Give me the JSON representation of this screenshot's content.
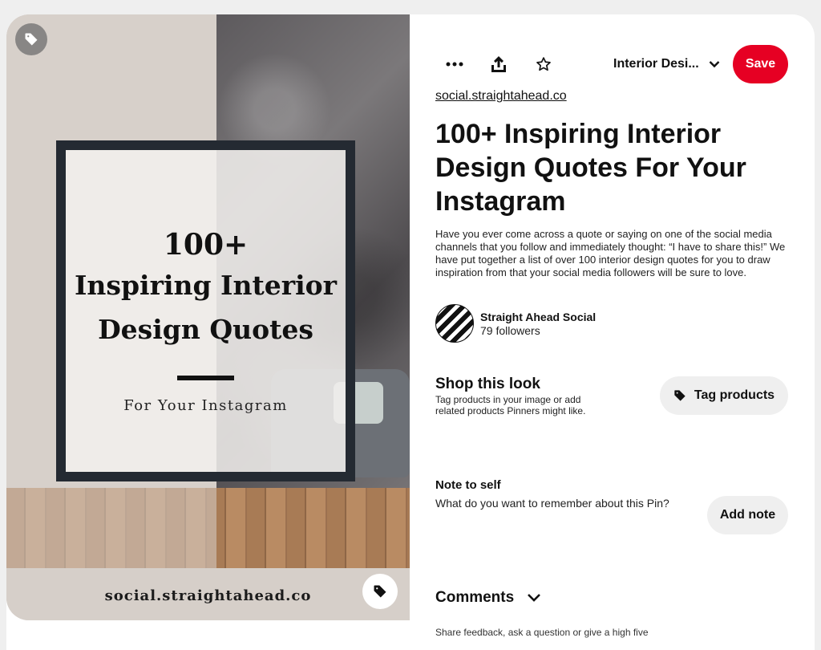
{
  "image": {
    "quote_line1": "100+",
    "quote_line2": "Inspiring Interior",
    "quote_line3": "Design Quotes",
    "quote_sub": "For Your Instagram",
    "footer_text": "social.straightahead.co"
  },
  "toolbar": {
    "icons": [
      "more-icon",
      "share-icon",
      "star-icon"
    ],
    "board_name": "Interior Desi...",
    "save_label": "Save"
  },
  "pin": {
    "source": "social.straightahead.co",
    "title": "100+ Inspiring Interior Design Quotes For Your Instagram",
    "description": "Have you ever come across a quote or saying on one of the social media channels that you follow and immediately thought: “I have to share this!” We have put together a list of over 100 interior design quotes for you to draw inspiration from that your social media followers will be sure to love."
  },
  "creator": {
    "name": "Straight Ahead Social",
    "followers": "79 followers"
  },
  "shop": {
    "title": "Shop this look",
    "description": "Tag products in your image or add related products Pinners might like.",
    "button_label": "Tag products"
  },
  "note": {
    "title": "Note to self",
    "description": "What do you want to remember about this Pin?",
    "button_label": "Add note"
  },
  "comments": {
    "title": "Comments",
    "hint": "Share feedback, ask a question or give a high five"
  },
  "colors": {
    "accent": "#e60023",
    "button_bg": "#efefef"
  }
}
